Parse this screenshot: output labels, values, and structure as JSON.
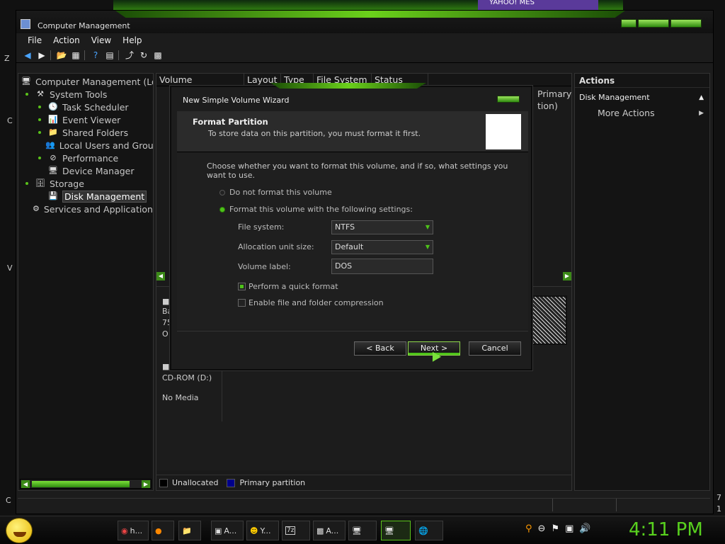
{
  "desktop": {
    "top_badge": "YAHOO! MES",
    "left_edge_letters": [
      "Z",
      "C",
      "V",
      "C"
    ],
    "right_edge_glyphs": [
      "7",
      "1"
    ]
  },
  "window": {
    "title": "Computer Management",
    "menu": [
      "File",
      "Action",
      "View",
      "Help"
    ],
    "toolbar_icons": [
      "back-arrow-icon",
      "forward-arrow-icon",
      "folder-up-icon",
      "show-hide-tree-icon",
      "help-icon",
      "properties-icon",
      "export-icon",
      "refresh-icon",
      "console-icon"
    ]
  },
  "tree": {
    "items": [
      {
        "label": "Computer Management (Loc",
        "icon": "computer-management-icon",
        "indent": 0
      },
      {
        "label": "System Tools",
        "icon": "tools-icon",
        "indent": 1,
        "bullet": true
      },
      {
        "label": "Task Scheduler",
        "icon": "clock-icon",
        "indent": 2,
        "bullet": true
      },
      {
        "label": "Event Viewer",
        "icon": "event-viewer-icon",
        "indent": 2,
        "bullet": true
      },
      {
        "label": "Shared Folders",
        "icon": "shared-folder-icon",
        "indent": 2,
        "bullet": true
      },
      {
        "label": "Local Users and Grou",
        "icon": "users-icon",
        "indent": 2,
        "bullet": true
      },
      {
        "label": "Performance",
        "icon": "performance-icon",
        "indent": 2,
        "bullet": true
      },
      {
        "label": "Device Manager",
        "icon": "device-manager-icon",
        "indent": 2,
        "bullet": false
      },
      {
        "label": "Storage",
        "icon": "storage-icon",
        "indent": 1,
        "bullet": true
      },
      {
        "label": "Disk Management",
        "icon": "disk-icon",
        "indent": 2,
        "bullet": false,
        "selected": true
      },
      {
        "label": "Services and Applications",
        "icon": "services-icon",
        "indent": 1,
        "bullet": true
      }
    ]
  },
  "center": {
    "columns": [
      "Volume",
      "Layout",
      "Type",
      "File System",
      "Status"
    ],
    "partial_text": [
      "Primary",
      "tion)"
    ],
    "disk_rows": [
      {
        "line1": "Ba",
        "line2": "75",
        "line3": "O"
      },
      {
        "name": "CD-ROM (D:)",
        "status": "No Media"
      }
    ],
    "legend": [
      {
        "label": "Unallocated",
        "color": "#000000"
      },
      {
        "label": "Primary partition",
        "color": "#00008b"
      }
    ]
  },
  "actions": {
    "header": "Actions",
    "section": "Disk Management",
    "more": "More Actions"
  },
  "dialog": {
    "title": "New Simple Volume Wizard",
    "heading": "Format Partition",
    "subheading": "To store data on this partition, you must format it first.",
    "intro": "Choose whether you want to format this volume, and if so, what settings you want to use.",
    "option_no_format": "Do not format this volume",
    "option_format": "Format this volume with the following settings:",
    "file_system_label": "File system:",
    "file_system_value": "NTFS",
    "alloc_label": "Allocation unit size:",
    "alloc_value": "Default",
    "volume_label_label": "Volume label:",
    "volume_label_value": "DOS",
    "quick_format": "Perform a quick format",
    "quick_format_checked": true,
    "compression": "Enable file and folder compression",
    "compression_checked": false,
    "back": "< Back",
    "next": "Next >",
    "cancel": "Cancel"
  },
  "taskbar": {
    "buttons": [
      {
        "label": "h...",
        "icon": "chrome-icon"
      },
      {
        "label": "",
        "icon": "firefox-icon"
      },
      {
        "label": "",
        "icon": "folder-icon"
      },
      {
        "label": "A...",
        "icon": "app-icon"
      },
      {
        "label": "Y...",
        "icon": "yahoo-messenger-icon"
      },
      {
        "label": "",
        "icon": "7zip-icon"
      },
      {
        "label": "A...",
        "icon": "cmd-icon"
      },
      {
        "label": "",
        "icon": "network-icon"
      },
      {
        "label": "",
        "icon": "computer-management-icon",
        "active": true
      },
      {
        "label": "",
        "icon": "globe-icon"
      }
    ],
    "clock": "4:11 PM"
  }
}
